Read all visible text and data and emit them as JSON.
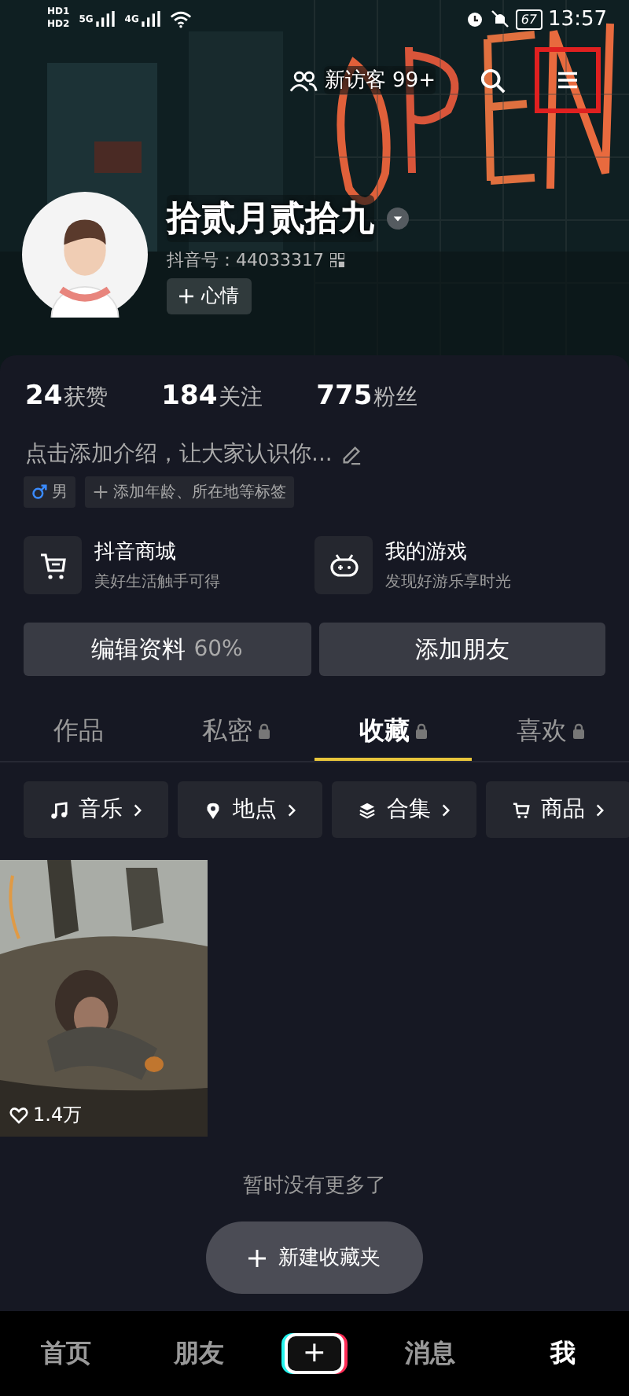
{
  "status_bar": {
    "sims": [
      {
        "badge": "HD",
        "slot": "1",
        "network": "5G"
      },
      {
        "badge": "HD",
        "slot": "2",
        "network": "4G"
      }
    ],
    "battery": "67",
    "time": "13:57"
  },
  "header": {
    "visitors": "新访客 99+",
    "menu_highlighted": true
  },
  "profile": {
    "name": "拾贰月贰拾九",
    "id_label": "抖音号：44033317",
    "mood": "心情"
  },
  "stats": [
    {
      "value": "24",
      "label": "获赞"
    },
    {
      "value": "184",
      "label": "关注"
    },
    {
      "value": "775",
      "label": "粉丝"
    }
  ],
  "bio": "点击添加介绍，让大家认识你...",
  "tags": [
    {
      "kind": "gender",
      "label": "男"
    },
    {
      "kind": "add",
      "label": "添加年龄、所在地等标签"
    }
  ],
  "shortcuts": [
    {
      "kind": "cart",
      "title": "抖音商城",
      "subtitle": "美好生活触手可得"
    },
    {
      "kind": "game",
      "title": "我的游戏",
      "subtitle": "发现好游乐享时光"
    }
  ],
  "buttons": [
    {
      "label": "编辑资料",
      "extra": "60%"
    },
    {
      "label": "添加朋友"
    }
  ],
  "tabs": [
    {
      "label": "作品",
      "locked": false,
      "selected": false
    },
    {
      "label": "私密",
      "locked": true,
      "selected": false
    },
    {
      "label": "收藏",
      "locked": true,
      "selected": true
    },
    {
      "label": "喜欢",
      "locked": true,
      "selected": false
    }
  ],
  "chips": [
    {
      "kind": "music",
      "label": "音乐"
    },
    {
      "kind": "location",
      "label": "地点"
    },
    {
      "kind": "collection",
      "label": "合集"
    },
    {
      "kind": "goods",
      "label": "商品"
    }
  ],
  "items": [
    {
      "kind": "picture",
      "likes": "1.4万"
    }
  ],
  "end_text": "暂时没有更多了",
  "new_folder": "新建收藏夹",
  "nav": [
    {
      "kind": "text",
      "label": "首页",
      "selected": false
    },
    {
      "kind": "text",
      "label": "朋友",
      "selected": false
    },
    {
      "kind": "create",
      "label": "+",
      "selected": false
    },
    {
      "kind": "text",
      "label": "消息",
      "selected": false
    },
    {
      "kind": "text",
      "label": "我",
      "selected": true
    }
  ]
}
